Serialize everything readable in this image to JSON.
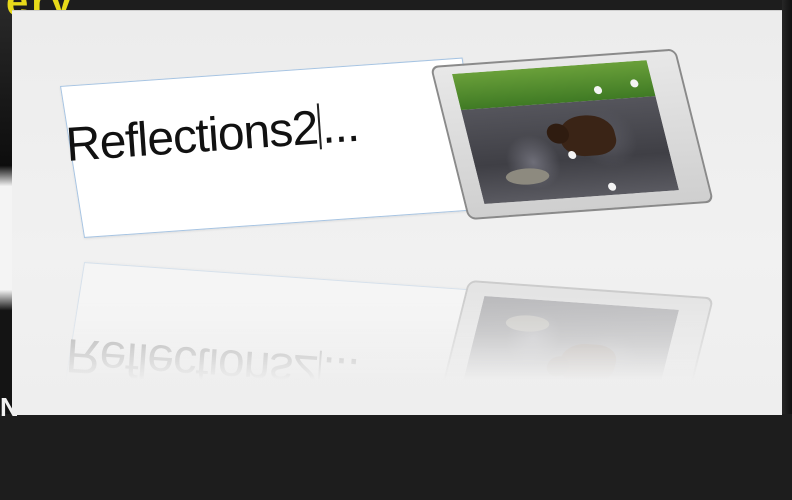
{
  "window": {
    "title_fragment": "ery",
    "bottom_glyph": "N"
  },
  "editor": {
    "text_value": "Reflections2",
    "ellipsis": "..."
  },
  "thumbnail": {
    "subject": "bear-in-river-photo"
  },
  "colors": {
    "background": "#1d1d1d",
    "panel": "#efefef",
    "textbox_border": "#a7c4e2",
    "title_accent": "#e8da1a"
  }
}
